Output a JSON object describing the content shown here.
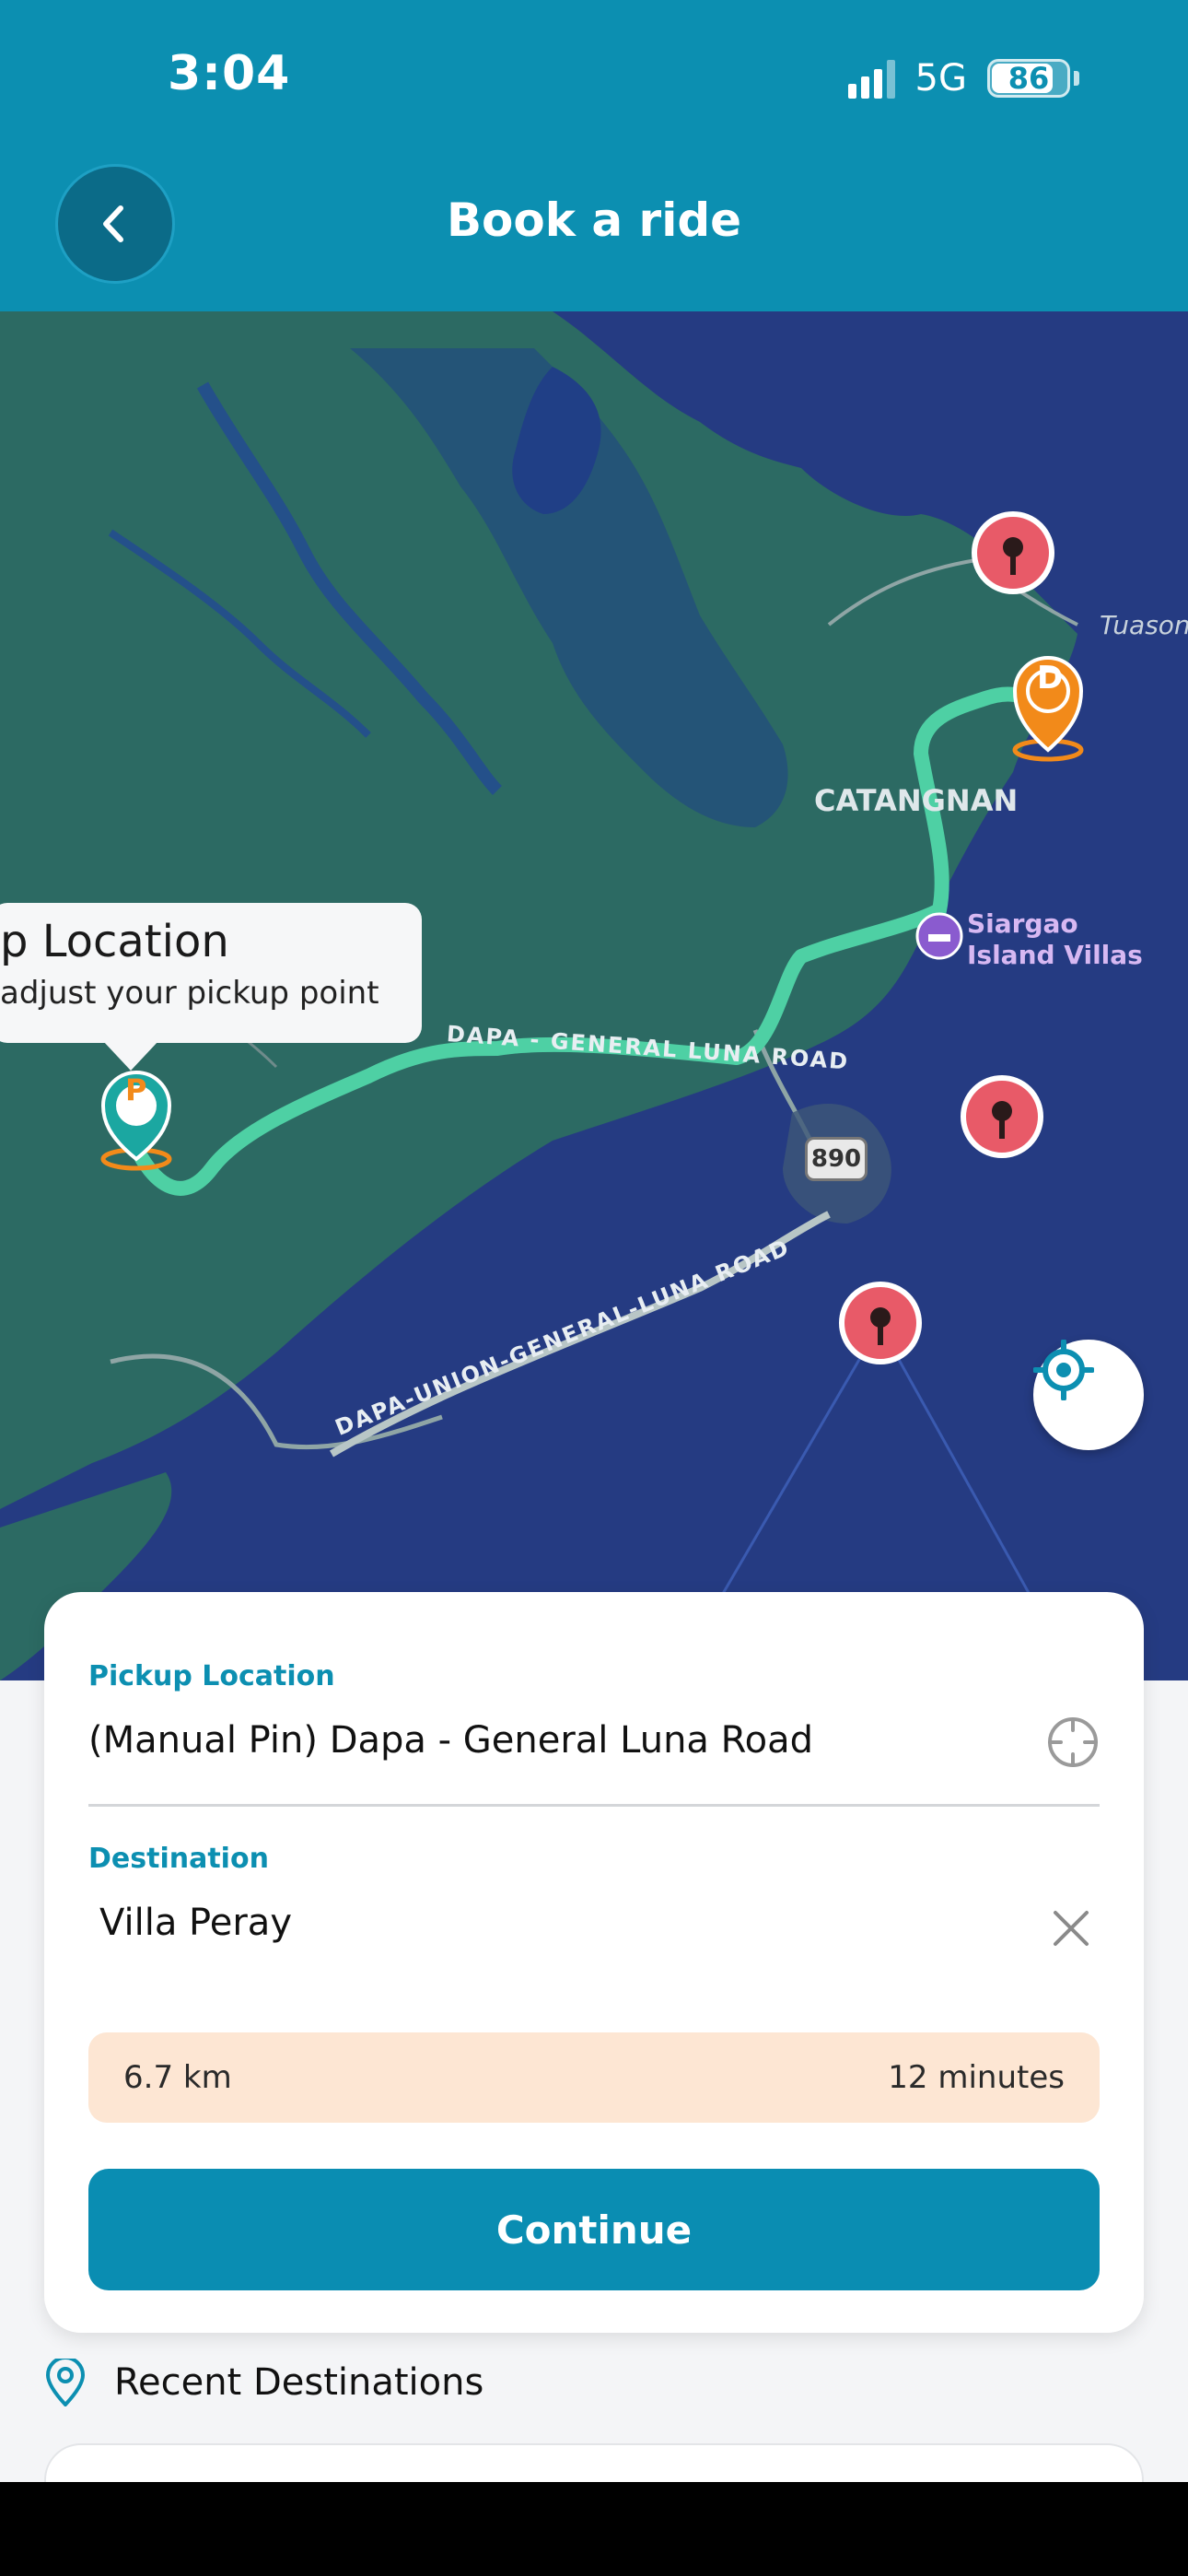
{
  "status_bar": {
    "time": "3:04",
    "network": "5G",
    "battery": "86"
  },
  "header": {
    "title": "Book a ride"
  },
  "map": {
    "labels": {
      "catangnan": "CATANGNAN",
      "tuason": "Tuason",
      "villas": "Siargao Island Villas",
      "road_upper": "DAPA - GENERAL LUNA ROAD",
      "road_lower": "DAPA-UNION-GENERAL-LUNA ROAD",
      "road_number": "890"
    },
    "tooltip": {
      "title": "p Location",
      "subtitle": "adjust your pickup point"
    },
    "pickup_marker": "P",
    "destination_marker": "D",
    "colors": {
      "water": "#253b82",
      "land": "#2c6a63",
      "route": "#4ed0a4",
      "pin_red": "#e85a68",
      "pin_orange": "#f28a1a",
      "pin_teal": "#1ba7a1"
    }
  },
  "booking": {
    "pickup_label": "Pickup Location",
    "pickup_value": "(Manual Pin) Dapa - General Luna Road",
    "destination_label": "Destination",
    "destination_value": "Villa Peray",
    "distance": "6.7 km",
    "duration": "12 minutes",
    "continue_label": "Continue"
  },
  "recent": {
    "title": "Recent Destinations"
  },
  "icons": {
    "back": "chevron-left-icon",
    "locate": "crosshair-target-icon",
    "pin_target": "target-icon",
    "clear": "close-icon",
    "recent": "location-pin-icon"
  }
}
